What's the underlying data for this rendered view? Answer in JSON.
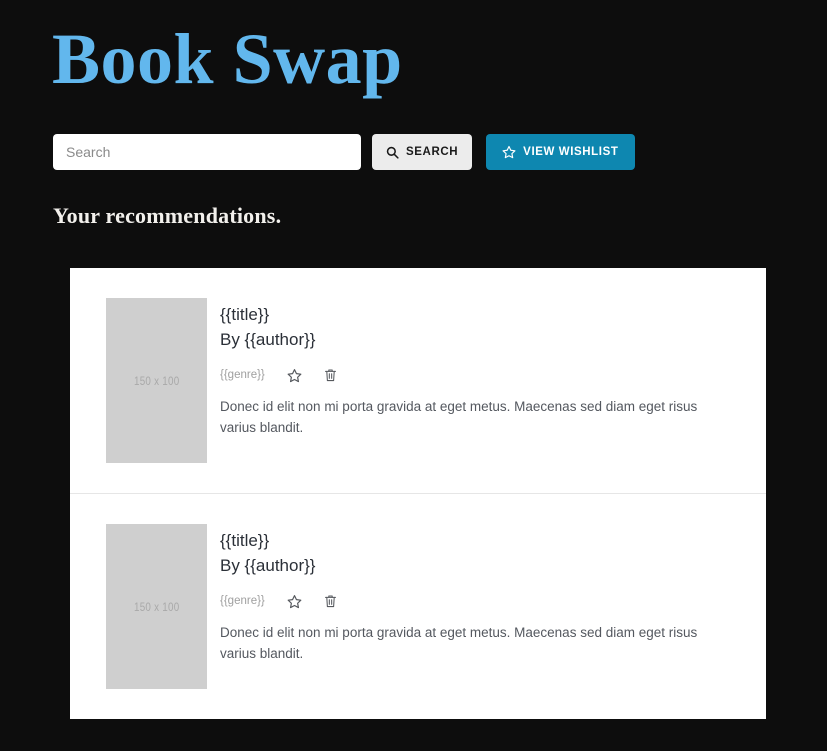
{
  "site": {
    "title": "Book Swap",
    "title_color": "#62b7ed",
    "background_color": "#0d0d0d"
  },
  "search": {
    "placeholder": "Search",
    "value": "",
    "search_button_label": "Search",
    "search_icon": "magnifier-icon",
    "wishlist_button_label": "View Wishlist",
    "wishlist_icon": "star-outline-icon",
    "wishlist_button_color": "#0e87b0",
    "search_button_color": "#ececec"
  },
  "main": {
    "heading": "Your recommendations.",
    "books": [
      {
        "cover_placeholder": "150 x 100",
        "title": "{{title}}",
        "author": "By {{author}}",
        "genre": "{{genre}}",
        "wishlist_icon": "star-outline-icon",
        "delete_icon": "trash-icon",
        "description": "Donec id elit non mi porta gravida at eget metus. Maecenas sed diam eget risus varius blandit."
      },
      {
        "cover_placeholder": "150 x 100",
        "title": "{{title}}",
        "author": "By {{author}}",
        "genre": "{{genre}}",
        "wishlist_icon": "star-outline-icon",
        "delete_icon": "trash-icon",
        "description": "Donec id elit non mi porta gravida at eget metus. Maecenas sed diam eget risus varius blandit."
      }
    ]
  }
}
